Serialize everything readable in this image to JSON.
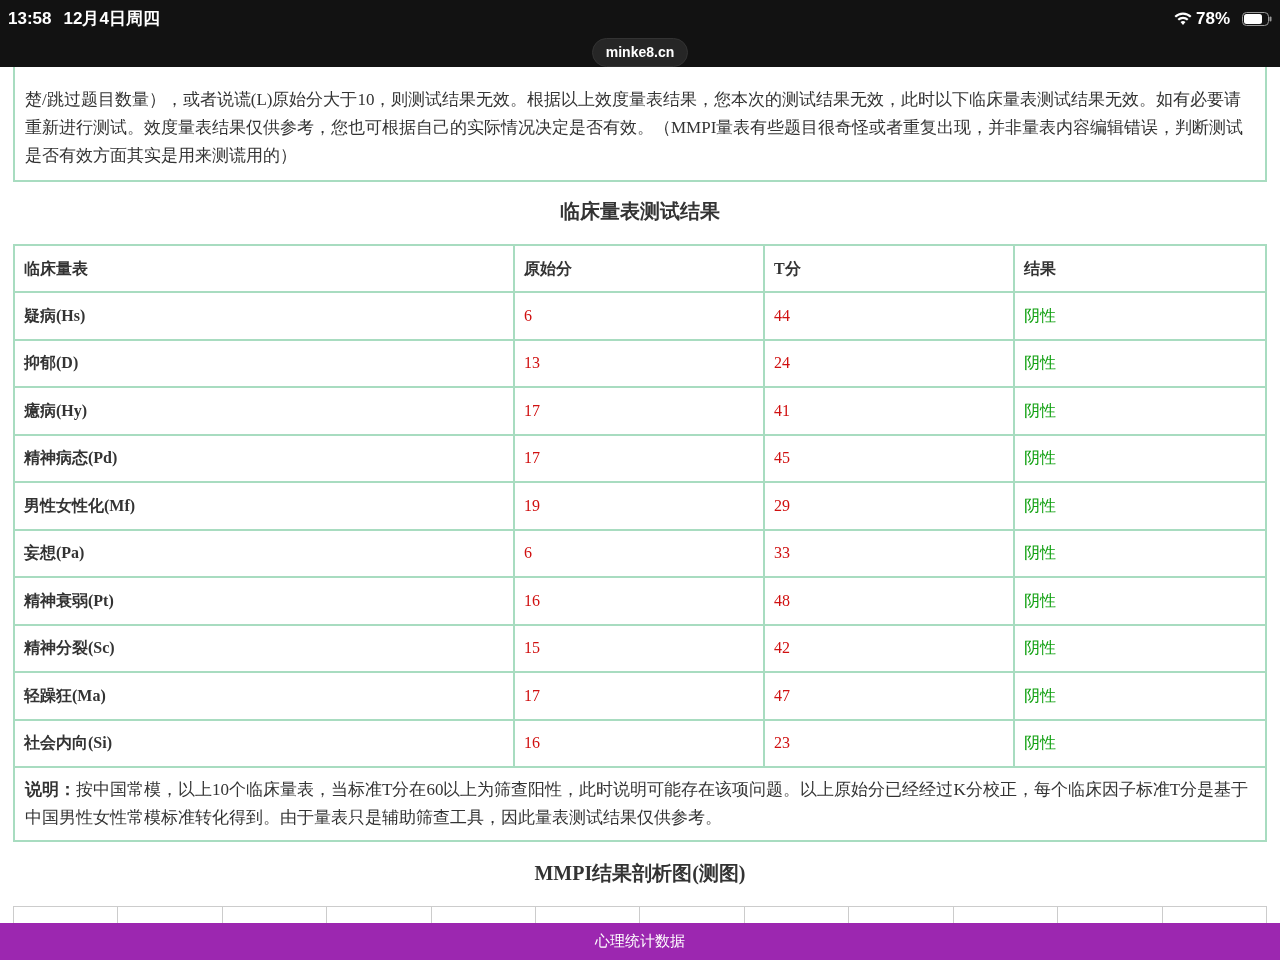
{
  "status_bar": {
    "time": "13:58",
    "date": "12月4日周四",
    "battery": "78%"
  },
  "address": "minke8.cn",
  "validity_note": {
    "text": "楚/跳过题目数量），或者说谎(L)原始分大于10，则测试结果无效。根据以上效度量表结果，您本次的测试结果无效，此时以下临床量表测试结果无效。如有必要请重新进行测试。效度量表结果仅供参考，您也可根据自己的实际情况决定是否有效。（MMPI量表有些题目很奇怪或者重复出现，并非量表内容编辑错误，判断测试是否有效方面其实是用来测谎用的）"
  },
  "clinical": {
    "title": "临床量表测试结果",
    "columns": [
      "临床量表",
      "原始分",
      "T分",
      "结果"
    ],
    "rows": [
      {
        "scale": "疑病(Hs)",
        "raw": "6",
        "t": "44",
        "result": "阴性"
      },
      {
        "scale": "抑郁(D)",
        "raw": "13",
        "t": "24",
        "result": "阴性"
      },
      {
        "scale": "癔病(Hy)",
        "raw": "17",
        "t": "41",
        "result": "阴性"
      },
      {
        "scale": "精神病态(Pd)",
        "raw": "17",
        "t": "45",
        "result": "阴性"
      },
      {
        "scale": "男性女性化(Mf)",
        "raw": "19",
        "t": "29",
        "result": "阴性"
      },
      {
        "scale": "妄想(Pa)",
        "raw": "6",
        "t": "33",
        "result": "阴性"
      },
      {
        "scale": "精神衰弱(Pt)",
        "raw": "16",
        "t": "48",
        "result": "阴性"
      },
      {
        "scale": "精神分裂(Sc)",
        "raw": "15",
        "t": "42",
        "result": "阴性"
      },
      {
        "scale": "轻躁狂(Ma)",
        "raw": "17",
        "t": "47",
        "result": "阴性"
      },
      {
        "scale": "社会内向(Si)",
        "raw": "16",
        "t": "23",
        "result": "阴性"
      }
    ],
    "note": {
      "label": "说明：",
      "text": "按中国常模，以上10个临床量表，当标准T分在60以上为筛查阳性，此时说明可能存在该项问题。以上原始分已经经过K分校正，每个临床因子标准T分是基于中国男性女性常模标准转化得到。由于量表只是辅助筛查工具，因此量表测试结果仅供参考。"
    }
  },
  "profile_chart": {
    "title": "MMPI结果剖析图(测图)"
  },
  "footer": "心理统计数据"
}
